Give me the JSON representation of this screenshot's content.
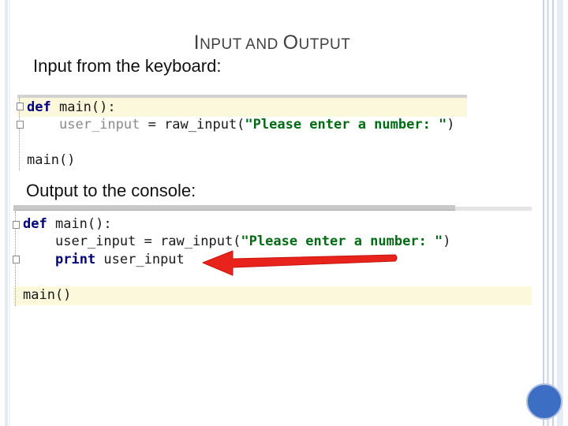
{
  "slide": {
    "title_first_cap": "I",
    "title_mid": "NPUT AND ",
    "title_second_cap": "O",
    "title_end": "UTPUT",
    "subtitle_input": "Input from the keyboard:",
    "subtitle_output": "Output to the console:"
  },
  "code_panel_input": {
    "line1_kw": "def",
    "line1_rest": " main():",
    "line2_var": "user_input",
    "line2_mid": " = raw_input(",
    "line2_str": "\"Please enter a number: \"",
    "line2_end": ")",
    "line4": "main()"
  },
  "code_panel_output": {
    "line1_kw": "def",
    "line1_rest": " main():",
    "line2_var": "user_input",
    "line2_mid": " = raw_input(",
    "line2_str": "\"Please enter a number: \"",
    "line2_end": ")",
    "line3_kw": "print",
    "line3_rest": " user_input",
    "line5": "main()"
  },
  "colors": {
    "keyword": "#00007a",
    "string": "#006a14",
    "highlight": "#fbf8dc",
    "arrow": "#e8231c",
    "accent_circle": "#3c6fc4"
  }
}
